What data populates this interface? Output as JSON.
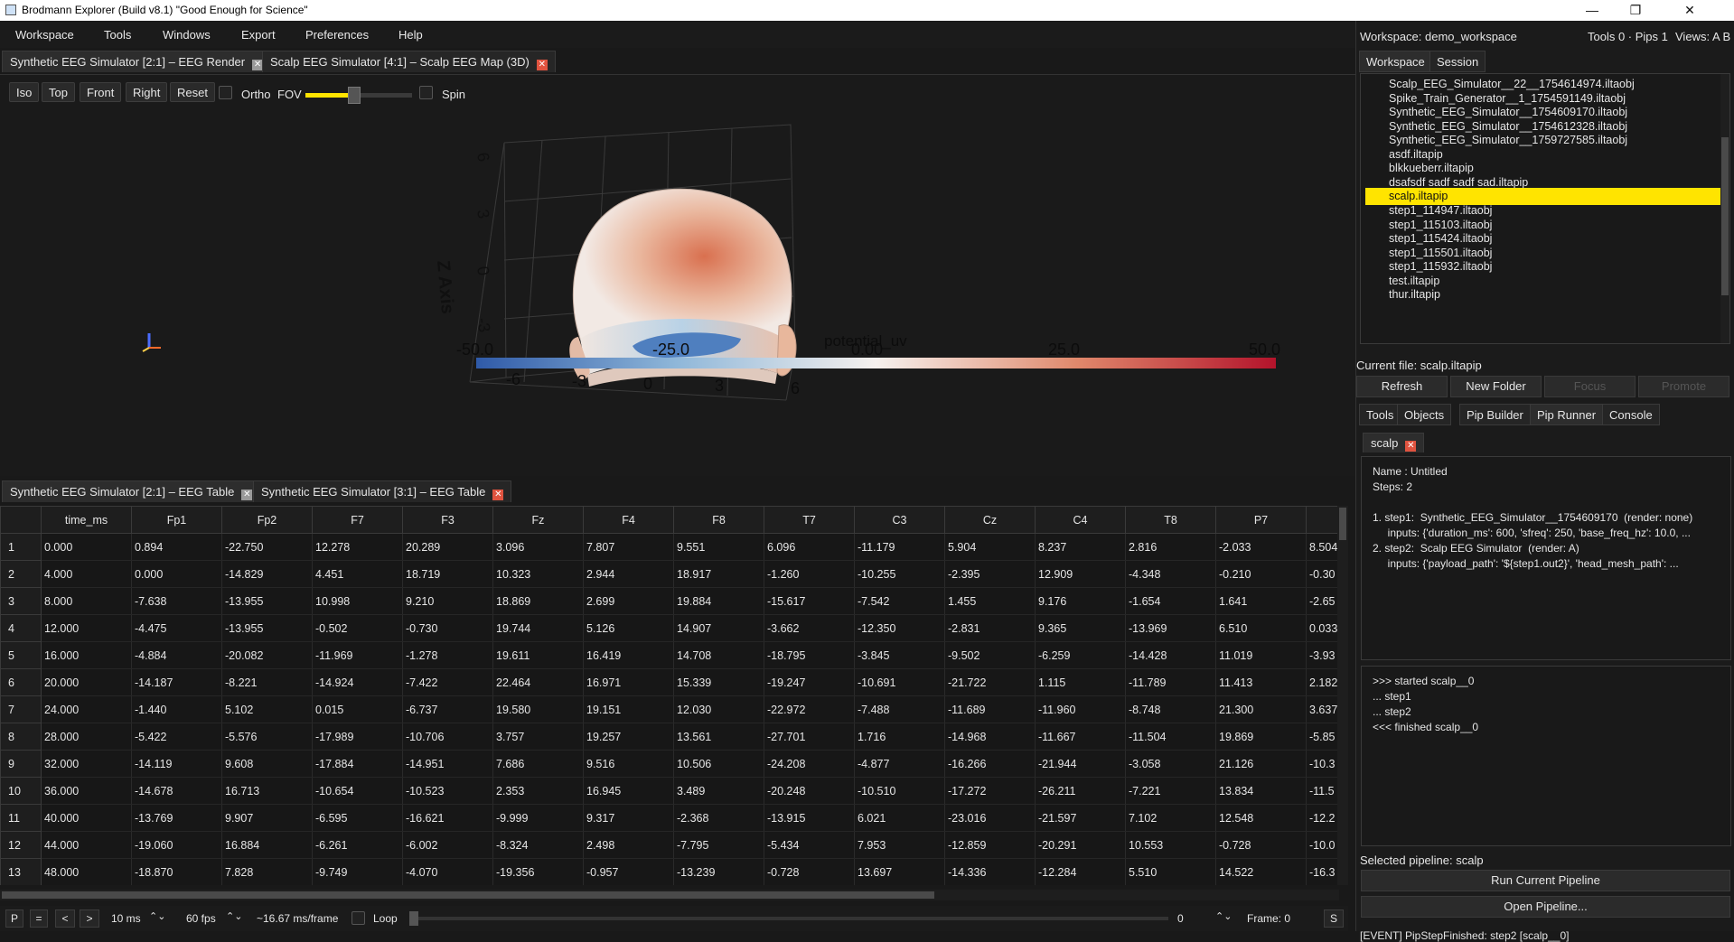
{
  "window": {
    "title": "Brodmann Explorer (Build v8.1) \"Good Enough for Science\"",
    "minimize": "—",
    "maximize": "❐",
    "close": "✕"
  },
  "menu": [
    "Workspace",
    "Tools",
    "Windows",
    "Export",
    "Preferences",
    "Help"
  ],
  "top_tabs": [
    {
      "label": "Synthetic EEG Simulator [2:1] – EEG Render"
    },
    {
      "label": "Scalp EEG Simulator [4:1] – Scalp EEG Map (3D)"
    }
  ],
  "viewport": {
    "buttons": [
      "Iso",
      "Top",
      "Front",
      "Right",
      "Reset"
    ],
    "ortho_label": "Ortho",
    "fov_label": "FOV",
    "fov_value": 0.55,
    "spin_label": "Spin",
    "z_axis_label": "Z Axis",
    "z_ticks": [
      "6",
      "3",
      "0",
      "-3"
    ],
    "x_ticks": [
      "-6",
      "-3",
      "0",
      "3",
      "6"
    ],
    "colorbar_title": "potential_uv",
    "colorbar_ticks": [
      "-50.0",
      "-25.0",
      "0.00",
      "25.0",
      "50.0"
    ],
    "colorbar_low": "#2f5aa8",
    "colorbar_high": "#b3132b"
  },
  "table_tabs": [
    {
      "label": "Synthetic EEG Simulator [2:1] – EEG Table"
    },
    {
      "label": "Synthetic EEG Simulator [3:1] – EEG Table"
    }
  ],
  "table": {
    "columns": [
      "time_ms",
      "Fp1",
      "Fp2",
      "F7",
      "F3",
      "Fz",
      "F4",
      "F8",
      "T7",
      "C3",
      "Cz",
      "C4",
      "T8",
      "P7",
      ""
    ],
    "rows": [
      [
        "0.000",
        "0.894",
        "-22.750",
        "12.278",
        "20.289",
        "3.096",
        "7.807",
        "9.551",
        "6.096",
        "-11.179",
        "5.904",
        "8.237",
        "2.816",
        "-2.033",
        "8.504"
      ],
      [
        "4.000",
        "0.000",
        "-14.829",
        "4.451",
        "18.719",
        "10.323",
        "2.944",
        "18.917",
        "-1.260",
        "-10.255",
        "-2.395",
        "12.909",
        "-4.348",
        "-0.210",
        "-0.30"
      ],
      [
        "8.000",
        "-7.638",
        "-13.955",
        "10.998",
        "9.210",
        "18.869",
        "2.699",
        "19.884",
        "-15.617",
        "-7.542",
        "1.455",
        "9.176",
        "-1.654",
        "1.641",
        "-2.65"
      ],
      [
        "12.000",
        "-4.475",
        "-13.955",
        "-0.502",
        "-0.730",
        "19.744",
        "5.126",
        "14.907",
        "-3.662",
        "-12.350",
        "-2.831",
        "9.365",
        "-13.969",
        "6.510",
        "0.033"
      ],
      [
        "16.000",
        "-4.884",
        "-20.082",
        "-11.969",
        "-1.278",
        "19.611",
        "16.419",
        "14.708",
        "-18.795",
        "-3.845",
        "-9.502",
        "-6.259",
        "-14.428",
        "11.019",
        "-3.93"
      ],
      [
        "20.000",
        "-14.187",
        "-8.221",
        "-14.924",
        "-7.422",
        "22.464",
        "16.971",
        "15.339",
        "-19.247",
        "-10.691",
        "-21.722",
        "1.115",
        "-11.789",
        "11.413",
        "2.182"
      ],
      [
        "24.000",
        "-1.440",
        "5.102",
        "0.015",
        "-6.737",
        "19.580",
        "19.151",
        "12.030",
        "-22.972",
        "-7.488",
        "-11.689",
        "-11.960",
        "-8.748",
        "21.300",
        "3.637"
      ],
      [
        "28.000",
        "-5.422",
        "-5.576",
        "-17.989",
        "-10.706",
        "3.757",
        "19.257",
        "13.561",
        "-27.701",
        "1.716",
        "-14.968",
        "-11.667",
        "-11.504",
        "19.869",
        "-5.85"
      ],
      [
        "32.000",
        "-14.119",
        "9.608",
        "-17.884",
        "-14.951",
        "7.686",
        "9.516",
        "10.506",
        "-24.208",
        "-4.877",
        "-16.266",
        "-21.944",
        "-3.058",
        "21.126",
        "-10.3"
      ],
      [
        "36.000",
        "-14.678",
        "16.713",
        "-10.654",
        "-10.523",
        "2.353",
        "16.945",
        "3.489",
        "-20.248",
        "-10.510",
        "-17.272",
        "-26.211",
        "-7.221",
        "13.834",
        "-11.5"
      ],
      [
        "40.000",
        "-13.769",
        "9.907",
        "-6.595",
        "-16.621",
        "-9.999",
        "9.317",
        "-2.368",
        "-13.915",
        "6.021",
        "-23.016",
        "-21.597",
        "7.102",
        "12.548",
        "-12.2"
      ],
      [
        "44.000",
        "-19.060",
        "16.884",
        "-6.261",
        "-6.002",
        "-8.324",
        "2.498",
        "-7.795",
        "-5.434",
        "7.953",
        "-12.859",
        "-20.291",
        "10.553",
        "-0.728",
        "-10.0"
      ],
      [
        "48.000",
        "-18.870",
        "7.828",
        "-9.749",
        "-4.070",
        "-19.356",
        "-0.957",
        "-13.239",
        "-0.728",
        "13.697",
        "-14.336",
        "-12.284",
        "5.510",
        "14.522",
        "-16.3"
      ]
    ]
  },
  "playback": {
    "play": "P",
    "stop": "=",
    "prev": "<",
    "next": ">",
    "interval": "10 ms",
    "fps": "60 fps",
    "ms_per_frame": "~16.67 ms/frame",
    "loop_label": "Loop",
    "frame_input": "0",
    "frame_label": "Frame: 0",
    "s_button": "S"
  },
  "right": {
    "workspace_label": "Workspace: demo_workspace",
    "status": "Tools 0 · Pips 1",
    "views": "Views: A B",
    "tabs": [
      "Workspace",
      "Session"
    ],
    "files": [
      "Scalp_EEG_Simulator__22__1754614974.iltaobj",
      "Spike_Train_Generator__1_1754591149.iltaobj",
      "Synthetic_EEG_Simulator__1754609170.iltaobj",
      "Synthetic_EEG_Simulator__1754612328.iltaobj",
      "Synthetic_EEG_Simulator__1759727585.iltaobj",
      "asdf.iltapip",
      "blkkueberr.iltapip",
      "dsafsdf sadf sadf sad.iltapip",
      "scalp.iltapip",
      "step1_114947.iltaobj",
      "step1_115103.iltaobj",
      "step1_115424.iltaobj",
      "step1_115501.iltaobj",
      "step1_115932.iltaobj",
      "test.iltapip",
      "thur.iltapip"
    ],
    "selected_index": 8,
    "current_file": "Current file: scalp.iltapip",
    "buttons": [
      "Refresh",
      "New Folder",
      "Focus",
      "Promote"
    ],
    "tool_tabs": [
      "Tools",
      "Objects",
      "Pip Builder",
      "Pip Runner",
      "Console"
    ],
    "pipeline_tab": "scalp",
    "pipeline_info": "Name : Untitled\nSteps: 2\n\n1. step1:  Synthetic_EEG_Simulator__1754609170  (render: none)\n     inputs: {'duration_ms': 600, 'sfreq': 250, 'base_freq_hz': 10.0, ...\n2. step2:  Scalp EEG Simulator  (render: A)\n     inputs: {'payload_path': '${step1.out2}', 'head_mesh_path': ...",
    "log": ">>> started scalp__0\n... step1\n... step2\n<<< finished scalp__0",
    "selected_pipeline": "Selected pipeline: scalp",
    "run_button": "Run Current Pipeline",
    "open_button": "Open Pipeline...",
    "event": "[EVENT] PipStepFinished: step2 [scalp__0]"
  },
  "colors": {
    "highlight": "#ffe400",
    "close_red": "#e0533f",
    "background": "#191919"
  }
}
